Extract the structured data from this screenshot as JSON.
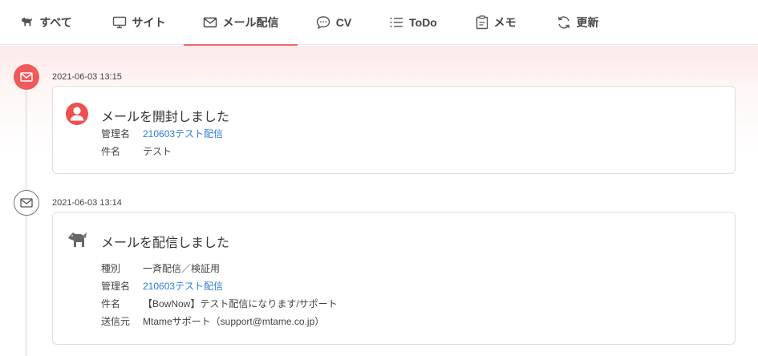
{
  "tabs": [
    {
      "label": "すべて",
      "icon": "dog-icon"
    },
    {
      "label": "サイト",
      "icon": "monitor-icon"
    },
    {
      "label": "メール配信",
      "icon": "envelope-icon",
      "active": true
    },
    {
      "label": "CV",
      "icon": "chat-bubble-icon"
    },
    {
      "label": "ToDo",
      "icon": "list-icon"
    },
    {
      "label": "メモ",
      "icon": "clipboard-icon"
    },
    {
      "label": "更新",
      "icon": "refresh-icon"
    }
  ],
  "colors": {
    "accent": "#f05a5a",
    "link": "#2f7ed8",
    "active_underline": "#e86a6a"
  },
  "events": [
    {
      "timestamp": "2021-06-03 13:15",
      "title": "メールを開封しました",
      "marker_icon": "envelope-icon",
      "card_icon": "user-avatar-icon",
      "rows": [
        {
          "label": "管理名",
          "value": "210603テスト配信",
          "link": true
        },
        {
          "label": "件名",
          "value": "テスト"
        }
      ]
    },
    {
      "timestamp": "2021-06-03 13:14",
      "title": "メールを配信しました",
      "marker_icon": "envelope-icon",
      "card_icon": "dog-icon",
      "rows": [
        {
          "label": "種別",
          "value": "一斉配信／検証用"
        },
        {
          "label": "管理名",
          "value": "210603テスト配信",
          "link": true
        },
        {
          "label": "件名",
          "value": "【BowNow】テスト配信になります/サポート"
        },
        {
          "label": "送信元",
          "value": "Mtameサポート（support@mtame.co.jp）"
        }
      ]
    }
  ]
}
